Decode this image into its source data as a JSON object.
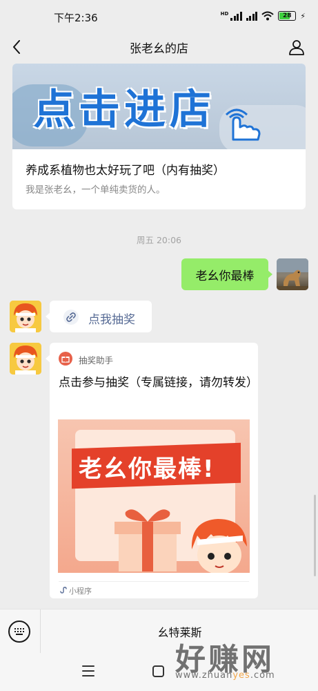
{
  "status_bar": {
    "time": "下午2:36",
    "network": "HD",
    "battery": "28"
  },
  "nav": {
    "title": "张老幺的店"
  },
  "article": {
    "banner_text": "点击进店",
    "title": "养成系植物也太好玩了吧（内有抽奖）",
    "description": "我是张老幺，一个单纯卖货的人。"
  },
  "timestamp": "周五 20:06",
  "messages": {
    "my_text": "老幺你最棒",
    "link_text": "点我抽奖"
  },
  "mini_program": {
    "app_name": "抽奖助手",
    "title": "点击参与抽奖（专属链接，请勿转发）",
    "image_text": "老幺你最棒!",
    "footer_label": "小程序"
  },
  "input_bar": {
    "menu_item": "幺特莱斯"
  },
  "watermark": {
    "main": "好赚网",
    "sub_prefix": "www.zhuan",
    "sub_highlight": "yes",
    "sub_suffix": ".com"
  },
  "colors": {
    "accent_green": "#95ec69",
    "link_blue": "#576b95",
    "banner_blue": "#1f73d6",
    "promo_red": "#e4412a",
    "watermark_orange": "#f29a2e"
  }
}
